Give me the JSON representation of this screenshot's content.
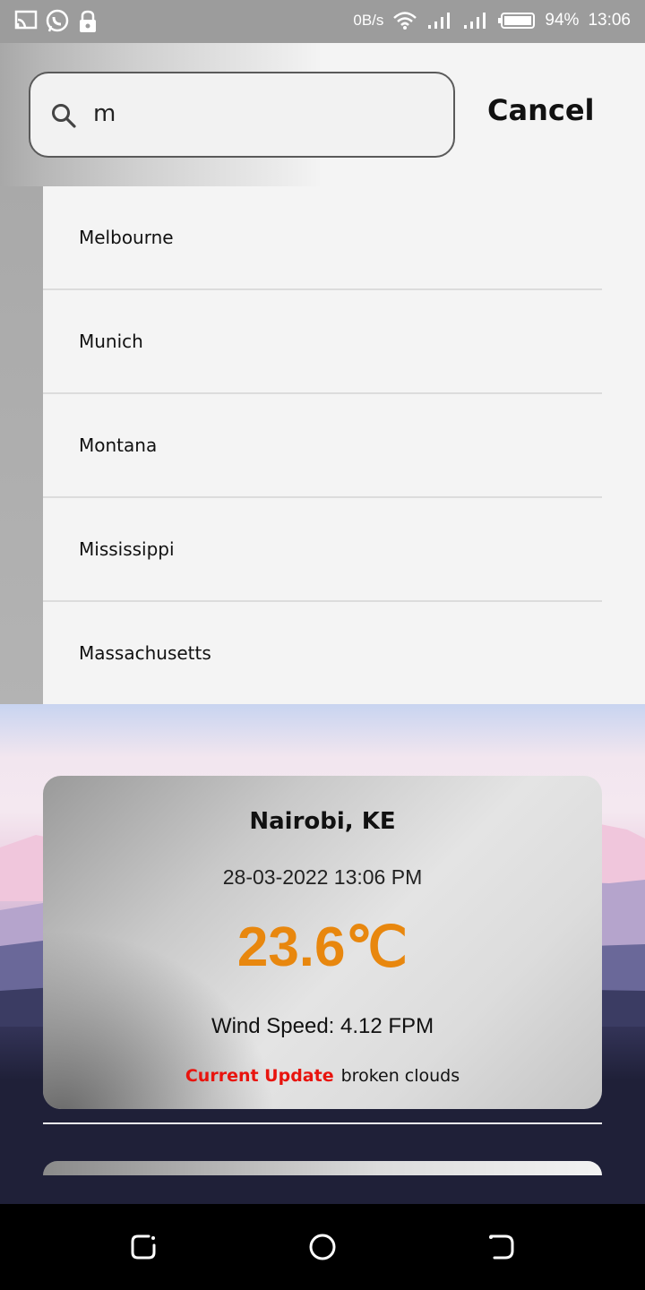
{
  "status_bar": {
    "net_speed": "0B/s",
    "battery": "94%",
    "time": "13:06",
    "icons": [
      "cast-icon",
      "whatsapp-icon",
      "lock-icon",
      "wifi-icon",
      "signal-icon",
      "signal-icon",
      "battery-icon"
    ]
  },
  "search": {
    "value": "m",
    "cancel_label": "Cancel"
  },
  "suggestions": [
    "Melbourne",
    "Munich",
    "Montana",
    "Mississippi",
    "Massachusetts"
  ],
  "weather": {
    "city": "Nairobi, KE",
    "datetime": "28-03-2022 13:06 PM",
    "temperature": "23.6℃",
    "wind": "Wind Speed: 4.12 FPM",
    "update_label": "Current Update",
    "description": "broken clouds"
  },
  "colors": {
    "temperature": "#e8870e",
    "update_label": "#e8140e"
  },
  "nav": [
    "recent-apps-icon",
    "home-icon",
    "back-icon"
  ]
}
